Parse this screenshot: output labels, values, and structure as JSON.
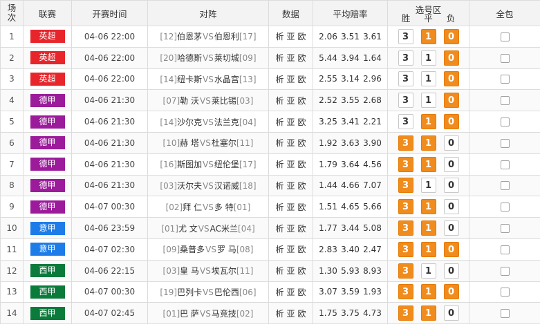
{
  "header": {
    "col_index": "场次",
    "col_league": "联赛",
    "col_time": "开赛时间",
    "col_match": "对阵",
    "col_data": "数据",
    "col_odds": "平均赔率",
    "col_pick": "选号区",
    "pick_win": "胜",
    "pick_draw": "平",
    "pick_lose": "负",
    "col_all": "全包"
  },
  "colors": {
    "英超": "#e8252b",
    "德甲": "#9b1b9b",
    "意甲": "#1e7ce8",
    "西甲": "#0b7b3c",
    "selected": "#f08c1e"
  },
  "data_links": [
    "析",
    "亚",
    "欧"
  ],
  "vs_label": "VS",
  "rows": [
    {
      "no": "1",
      "league": "英超",
      "time": "04-06 22:00",
      "home_rank": "[12]",
      "home": "伯恩茅",
      "away": "伯恩利",
      "away_rank": "[17]",
      "odds": [
        "2.06",
        "3.51",
        "3.61"
      ],
      "sel": [
        false,
        true,
        true
      ]
    },
    {
      "no": "2",
      "league": "英超",
      "time": "04-06 22:00",
      "home_rank": "[20]",
      "home": "哈德斯",
      "away": "莱切城",
      "away_rank": "[09]",
      "odds": [
        "5.44",
        "3.94",
        "1.64"
      ],
      "sel": [
        false,
        false,
        true
      ]
    },
    {
      "no": "3",
      "league": "英超",
      "time": "04-06 22:00",
      "home_rank": "[14]",
      "home": "纽卡斯",
      "away": "水晶宫",
      "away_rank": "[13]",
      "odds": [
        "2.55",
        "3.14",
        "2.96"
      ],
      "sel": [
        false,
        false,
        true
      ]
    },
    {
      "no": "4",
      "league": "德甲",
      "time": "04-06 21:30",
      "home_rank": "[07]",
      "home": "勒 沃",
      "away": "莱比锡",
      "away_rank": "[03]",
      "odds": [
        "2.52",
        "3.55",
        "2.68"
      ],
      "sel": [
        false,
        false,
        true
      ]
    },
    {
      "no": "5",
      "league": "德甲",
      "time": "04-06 21:30",
      "home_rank": "[14]",
      "home": "沙尔克",
      "away": "法兰克",
      "away_rank": "[04]",
      "odds": [
        "3.25",
        "3.41",
        "2.21"
      ],
      "sel": [
        false,
        true,
        true
      ]
    },
    {
      "no": "6",
      "league": "德甲",
      "time": "04-06 21:30",
      "home_rank": "[10]",
      "home": "赫 塔",
      "away": "杜塞尔",
      "away_rank": "[11]",
      "odds": [
        "1.92",
        "3.63",
        "3.90"
      ],
      "sel": [
        true,
        true,
        false
      ]
    },
    {
      "no": "7",
      "league": "德甲",
      "time": "04-06 21:30",
      "home_rank": "[16]",
      "home": "斯图加",
      "away": "纽伦堡",
      "away_rank": "[17]",
      "odds": [
        "1.79",
        "3.64",
        "4.56"
      ],
      "sel": [
        true,
        true,
        false
      ]
    },
    {
      "no": "8",
      "league": "德甲",
      "time": "04-06 21:30",
      "home_rank": "[03]",
      "home": "沃尔夫",
      "away": "汉诺威",
      "away_rank": "[18]",
      "odds": [
        "1.44",
        "4.66",
        "7.07"
      ],
      "sel": [
        true,
        false,
        false
      ]
    },
    {
      "no": "9",
      "league": "德甲",
      "time": "04-07 00:30",
      "home_rank": "[02]",
      "home": "拜 仁",
      "away": "多 特",
      "away_rank": "[01]",
      "odds": [
        "1.51",
        "4.65",
        "5.66"
      ],
      "sel": [
        true,
        true,
        false
      ]
    },
    {
      "no": "10",
      "league": "意甲",
      "time": "04-06 23:59",
      "home_rank": "[01]",
      "home": "尤 文",
      "away": "AC米兰",
      "away_rank": "[04]",
      "odds": [
        "1.77",
        "3.44",
        "5.08"
      ],
      "sel": [
        true,
        true,
        false
      ]
    },
    {
      "no": "11",
      "league": "意甲",
      "time": "04-07 02:30",
      "home_rank": "[09]",
      "home": "桑普多",
      "away": "罗 马",
      "away_rank": "[08]",
      "odds": [
        "2.83",
        "3.40",
        "2.47"
      ],
      "sel": [
        true,
        true,
        true
      ]
    },
    {
      "no": "12",
      "league": "西甲",
      "time": "04-06 22:15",
      "home_rank": "[03]",
      "home": "皇 马",
      "away": "埃瓦尔",
      "away_rank": "[11]",
      "odds": [
        "1.30",
        "5.93",
        "8.93"
      ],
      "sel": [
        true,
        false,
        false
      ]
    },
    {
      "no": "13",
      "league": "西甲",
      "time": "04-07 00:30",
      "home_rank": "[19]",
      "home": "巴列卡",
      "away": "巴伦西",
      "away_rank": "[06]",
      "odds": [
        "3.07",
        "3.59",
        "1.93"
      ],
      "sel": [
        true,
        true,
        true
      ]
    },
    {
      "no": "14",
      "league": "西甲",
      "time": "04-07 02:45",
      "home_rank": "[01]",
      "home": "巴 萨",
      "away": "马竞技",
      "away_rank": "[02]",
      "odds": [
        "1.75",
        "3.75",
        "4.73"
      ],
      "sel": [
        true,
        true,
        false
      ]
    }
  ],
  "pick_values": [
    "3",
    "1",
    "0"
  ]
}
